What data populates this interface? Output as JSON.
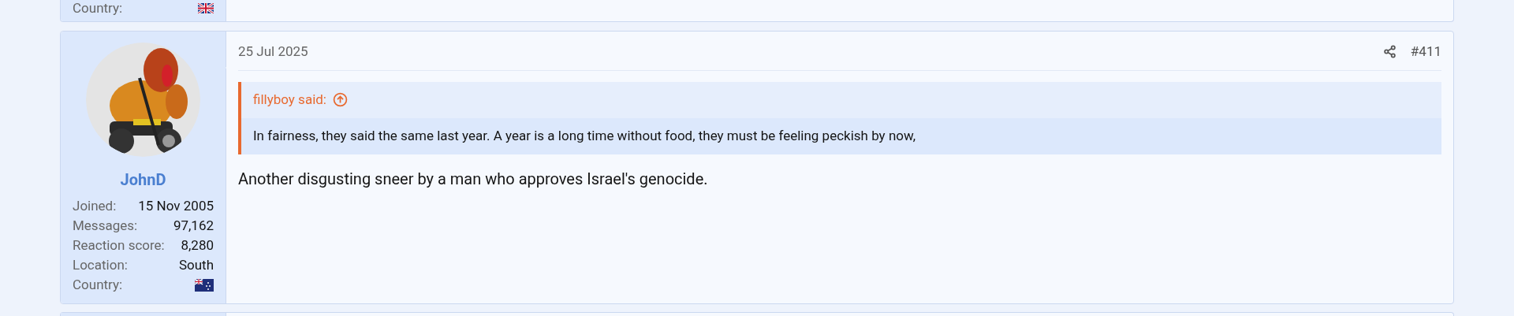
{
  "previous_post": {
    "user_stats": [
      {
        "kind": "unionjack",
        "label": "Country:"
      }
    ]
  },
  "post": {
    "date": "25 Jul 2025",
    "number": "#411",
    "user": {
      "name": "JohnD",
      "stats": [
        {
          "kind": "text",
          "label": "Joined:",
          "value": "15 Nov 2005"
        },
        {
          "kind": "text",
          "label": "Messages:",
          "value": "97,162"
        },
        {
          "kind": "text",
          "label": "Reaction score:",
          "value": "8,280"
        },
        {
          "kind": "text",
          "label": "Location:",
          "value": "South"
        },
        {
          "kind": "nzflag",
          "label": "Country:"
        }
      ]
    },
    "quote": {
      "author": "fillyboy said:",
      "text": "In fairness, they said the same last year. A year is a long time without food, they must be feeling peckish by now,"
    },
    "body": "Another disgusting sneer by a man who approves Israel's genocide."
  }
}
